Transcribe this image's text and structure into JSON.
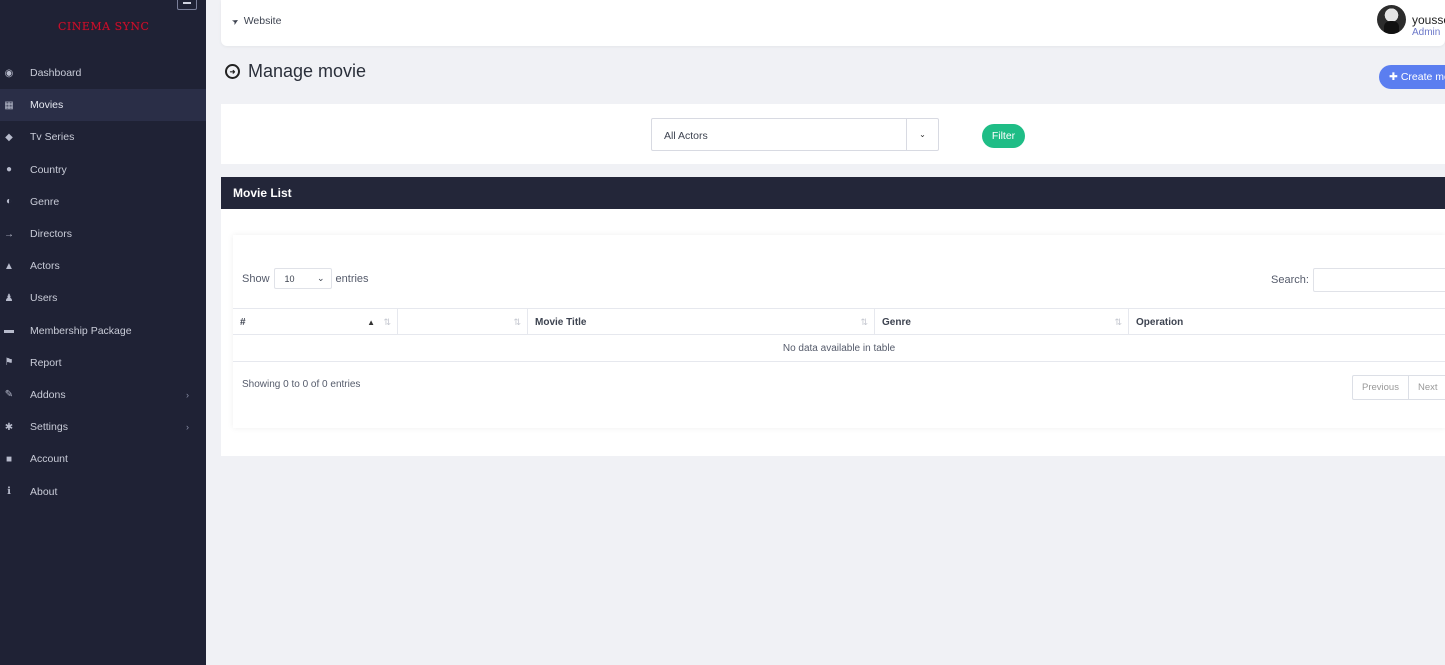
{
  "sidebar": {
    "logo": "CINEMA SYNC",
    "items": [
      {
        "label": "Dashboard",
        "icon": "dashboard-icon"
      },
      {
        "label": "Movies",
        "icon": "film-icon",
        "active": true
      },
      {
        "label": "Tv Series",
        "icon": "ticket-icon"
      },
      {
        "label": "Country",
        "icon": "globe-icon"
      },
      {
        "label": "Genre",
        "icon": "genre-icon"
      },
      {
        "label": "Directors",
        "icon": "arrow-right-icon"
      },
      {
        "label": "Actors",
        "icon": "user-icon"
      },
      {
        "label": "Users",
        "icon": "users-icon"
      },
      {
        "label": "Membership Package",
        "icon": "cart-icon"
      },
      {
        "label": "Report",
        "icon": "flag-icon"
      },
      {
        "label": "Addons",
        "icon": "plug-icon",
        "chevron": "›"
      },
      {
        "label": "Settings",
        "icon": "gear-icon",
        "chevron": "›"
      },
      {
        "label": "Account",
        "icon": "lock-icon"
      },
      {
        "label": "About",
        "icon": "info-icon"
      }
    ]
  },
  "topbar": {
    "website_label": "Website",
    "user_name": "yousse",
    "user_role": "Admin"
  },
  "header": {
    "title": "Manage movie",
    "create_button": "Create mo"
  },
  "filter": {
    "actor_select_value": "All Actors",
    "filter_button": "Filter"
  },
  "movie_list": {
    "title": "Movie List",
    "show_label": "Show",
    "entries_select_value": "10",
    "entries_label": "entries",
    "search_label": "Search:",
    "columns": [
      "#",
      "",
      "Movie Title",
      "Genre",
      "Operation"
    ],
    "empty_text": "No data available in table",
    "info_text": "Showing 0 to 0 of 0 entries",
    "pagination": {
      "previous": "Previous",
      "next": "Next"
    }
  },
  "colors": {
    "sidebar_bg": "#1f2235",
    "accent_blue": "#5b7ef0",
    "filter_green": "#1fbd86",
    "logo_red": "#c8102e"
  }
}
